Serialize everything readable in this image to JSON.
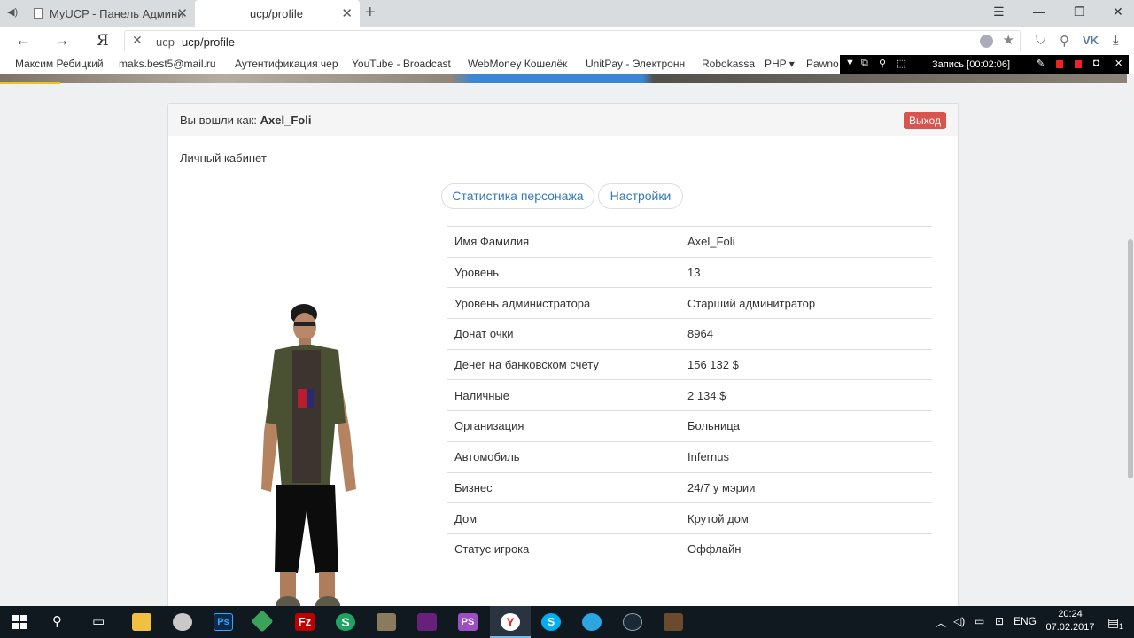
{
  "browser": {
    "tabs": [
      {
        "label": "MyUCP - Панель Администр"
      },
      {
        "label": "ucp/profile"
      }
    ],
    "address": {
      "host": "ucp",
      "path": "ucp/profile"
    },
    "yandex_logo": "Я",
    "bookmarks": [
      "Максим Ребицкий",
      "maks.best5@mail.ru",
      "Аутентификация чер",
      "YouTube - Broadcast",
      "WebMoney Кошелёк",
      "UnitPay - Электронн",
      "Robokassa",
      "PHP ▾",
      "Pawno"
    ],
    "vk_label": "VK"
  },
  "recorder": {
    "label": "Запись [00:02:06]"
  },
  "panel": {
    "login_prefix": "Вы вошли как:",
    "login_user": "Axel_Foli",
    "logout_label": "Выход",
    "cabinet_label": "Личный кабинет",
    "tabs": [
      {
        "label": "Статистика персонажа"
      },
      {
        "label": "Настройки"
      }
    ],
    "stats": [
      {
        "key": "Имя Фамилия",
        "value": "Axel_Foli"
      },
      {
        "key": "Уровень",
        "value": "13"
      },
      {
        "key": "Уровень администратора",
        "value": "Старший админитратор"
      },
      {
        "key": "Донат очки",
        "value": "8964"
      },
      {
        "key": "Денег на банковском счету",
        "value": "156 132 $"
      },
      {
        "key": "Наличные",
        "value": "2 134 $"
      },
      {
        "key": "Организация",
        "value": "Больница"
      },
      {
        "key": "Автомобиль",
        "value": "Infernus"
      },
      {
        "key": "Бизнес",
        "value": "24/7 у мэрии"
      },
      {
        "key": "Дом",
        "value": "Крутой дом"
      },
      {
        "key": "Статус игрока",
        "value": "Оффлайн"
      }
    ]
  },
  "taskbar": {
    "lang": "ENG",
    "time": "20:24",
    "date": "07.02.2017",
    "notification_count": "1"
  },
  "colors": {
    "danger": "#d9534f",
    "link": "#337ab7",
    "taskbar": "#101820"
  }
}
